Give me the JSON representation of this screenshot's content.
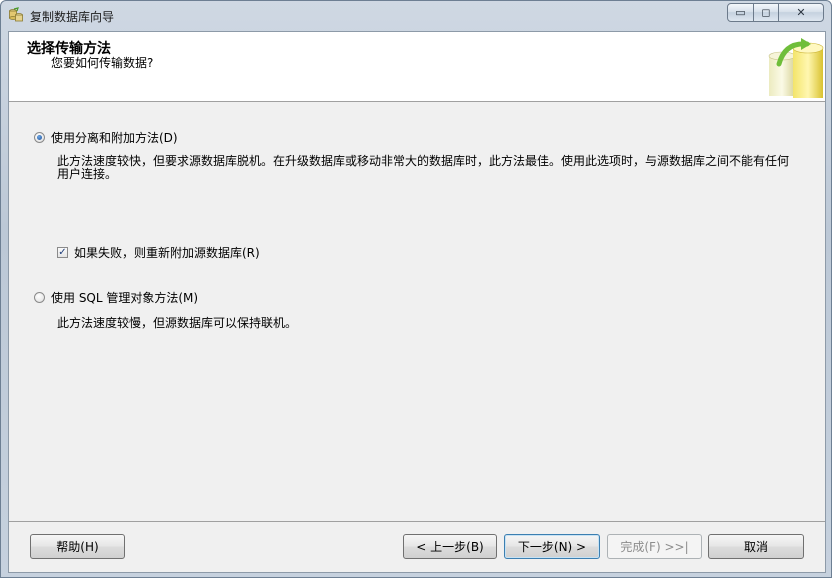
{
  "window": {
    "title": "复制数据库向导",
    "minimize_glyph": "▭",
    "maximize_glyph": "◻",
    "close_glyph": "✕"
  },
  "header": {
    "title": "选择传输方法",
    "subtitle": "您要如何传输数据?"
  },
  "options": {
    "detach": {
      "label": "使用分离和附加方法(D)",
      "selected": true,
      "description_1": "此方法速度较快，但要求源数据库脱机。在升级数据库或移动非常大的数据库时，此方法最佳。使用此选项时，与源数据库之间不能有任何",
      "description_2": "用户连接。",
      "reattach": {
        "label": "如果失败，则重新附加源数据库(R)",
        "checked": true,
        "check_glyph": "✓"
      }
    },
    "smo": {
      "label": "使用 SQL 管理对象方法(M)",
      "selected": false,
      "description": "此方法速度较慢，但源数据库可以保持联机。"
    }
  },
  "buttons": {
    "help": "帮助(H)",
    "back": "< 上一步(B)",
    "next": "下一步(N) >",
    "finish": "完成(F) >>|",
    "cancel": "取消"
  }
}
